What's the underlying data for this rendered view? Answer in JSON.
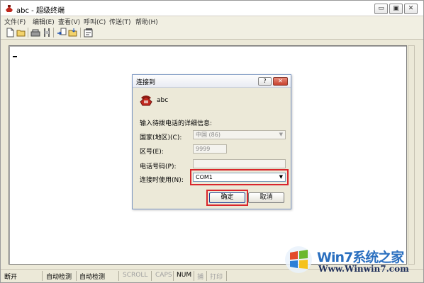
{
  "window": {
    "title": "abc - 超级终端",
    "min_label": "▭",
    "max_label": "▣",
    "close_label": "✕"
  },
  "menu": [
    {
      "label": "文件(F)"
    },
    {
      "label": "编辑(E)"
    },
    {
      "label": "查看(V)"
    },
    {
      "label": "呼叫(C)"
    },
    {
      "label": "传送(T)"
    },
    {
      "label": "帮助(H)"
    }
  ],
  "toolbar": {
    "icons": [
      "new-icon",
      "open-icon",
      "connect-icon",
      "disconnect-icon",
      "send-icon",
      "receive-icon",
      "properties-icon"
    ]
  },
  "terminal": {
    "content": ""
  },
  "dialog": {
    "title": "连接到",
    "help_label": "?",
    "close_label": "✕",
    "connection_name": "abc",
    "prompt": "输入待拨电话的详细信息:",
    "country_label": "国家(地区)(C):",
    "country_value": "中国 (86)",
    "area_label": "区号(E):",
    "area_value": "9999",
    "phone_label": "电话号码(P):",
    "phone_value": "",
    "connect_using_label": "连接时使用(N):",
    "connect_using_value": "COM1",
    "ok_label": "确定",
    "cancel_label": "取消",
    "highlight_color": "#d9262c"
  },
  "status": {
    "disconnected": "断开",
    "auto_detect_1": "自动检测",
    "auto_detect_2": "自动检测",
    "scroll": "SCROLL",
    "caps": "CAPS",
    "num": "NUM",
    "capture": "捕",
    "print": "打印"
  },
  "watermark": {
    "brand": "Win7系统之家",
    "url": "Www.Winwin7.com"
  }
}
